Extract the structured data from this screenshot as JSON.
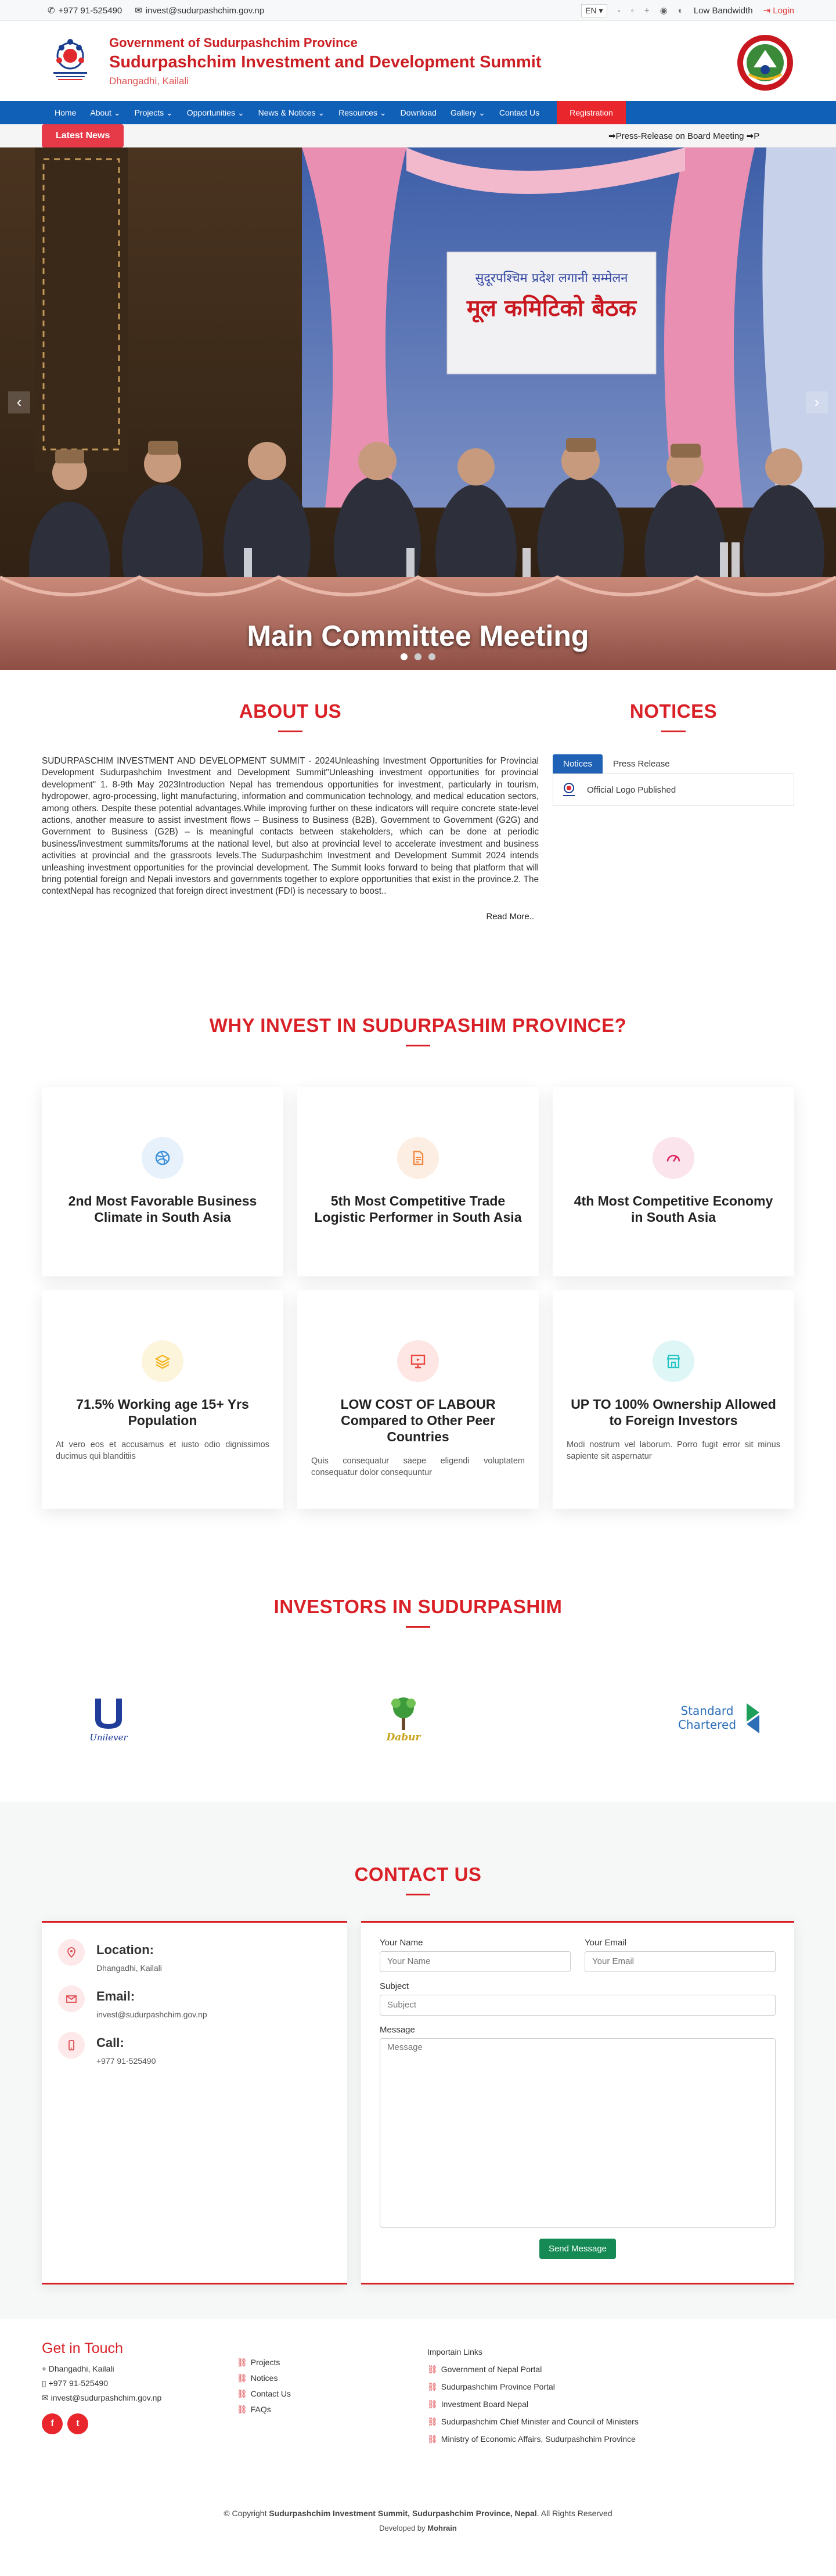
{
  "topbar": {
    "phone": "+977 91-525490",
    "email": "invest@sudurpashchim.gov.np",
    "language": "EN",
    "low_bandwidth": "Low Bandwidth",
    "login": "Login"
  },
  "header": {
    "gov_line": "Government of Sudurpashchim Province",
    "summit_title": "Sudurpashchim Investment and Development Summit",
    "location": "Dhangadhi, Kailali"
  },
  "nav": {
    "items": [
      "Home",
      "About ⌄",
      "Projects ⌄",
      "Opportunities ⌄",
      "News & Notices ⌄",
      "Resources ⌄",
      "Download",
      "Gallery ⌄",
      "Contact Us"
    ],
    "registration": "Registration"
  },
  "ticker": {
    "label": "Latest News",
    "text": "➡Press-Release on Board Meeting   ➡P"
  },
  "hero": {
    "caption": "Main Committee Meeting",
    "banner_text": "मूल कमिटिको बैठक",
    "prev": "‹",
    "next": "›"
  },
  "about": {
    "title": "ABOUT US",
    "body": "SUDURPASCHIM INVESTMENT AND DEVELOPMENT SUMMIT - 2024Unleashing Investment Opportunities for Provincial Development Sudurpashchim Investment and Development Summit\"Unleashing investment opportunities for provincial development\" 1.            8-9th May 2023Introduction Nepal has tremendous opportunities for investment, particularly in tourism, hydropower, agro-processing, light manufacturing, information and communication technology, and medical education sectors, among others. Despite these potential advantages.While improving further on these indicators will require concrete state-level actions, another measure to assist investment flows – Business to Business (B2B), Government to Government (G2G) and Government to Business (G2B) – is meaningful contacts between stakeholders, which can be done at periodic business/investment summits/forums at the national level, but also at provincial level to accelerate investment and business activities at provincial and the grassroots levels.The Sudurpashchim Investment and Development Summit 2024 intends unleashing investment opportunities for the provincial development. The Summit looks forward to being that platform that will bring potential foreign and Nepali investors and governments together to explore opportunities that exist in the province.2.           The contextNepal has recognized that foreign direct investment (FDI) is necessary to boost..",
    "read_more": "Read More.."
  },
  "notices": {
    "title": "NOTICES",
    "tabs": [
      "Notices",
      "Press Release"
    ],
    "items": [
      "Official Logo Published"
    ]
  },
  "why": {
    "title": "WHY INVEST IN SUDURPASHIM PROVINCE?",
    "cards": [
      {
        "title": "2nd Most Favorable Business Climate in South Asia",
        "text": "",
        "icon": "dribbble-icon",
        "color": "#3b8fd9",
        "bg": "#e6f1fb"
      },
      {
        "title": "5th Most Competitive Trade Logistic Performer in South Asia",
        "text": "",
        "icon": "document-icon",
        "color": "#f08a44",
        "bg": "#fdeee3"
      },
      {
        "title": "4th Most Competitive Economy in South Asia",
        "text": "",
        "icon": "speedometer-icon",
        "color": "#e0245e",
        "bg": "#fbe4ec"
      },
      {
        "title": "71.5% Working age 15+ Yrs Population",
        "text": "At vero eos et accusamus et iusto odio dignissimos ducimus qui blanditiis",
        "icon": "layers-icon",
        "color": "#f2b31b",
        "bg": "#fdf4dc"
      },
      {
        "title": "LOW COST OF LABOUR Compared to Other Peer Countries",
        "text": "Quis consequatur saepe eligendi voluptatem consequatur dolor consequuntur",
        "icon": "presentation-icon",
        "color": "#e8463c",
        "bg": "#fde6e3"
      },
      {
        "title": "UP TO 100% Ownership Allowed to Foreign Investors",
        "text": "Modi nostrum vel laborum. Porro fugit error sit minus sapiente sit aspernatur",
        "icon": "storefront-icon",
        "color": "#23c4c4",
        "bg": "#dff6f6"
      }
    ]
  },
  "investors": {
    "title": "INVESTORS IN SUDURPASHIM",
    "logos": [
      "Unilever",
      "Dabur",
      "Standard Chartered"
    ]
  },
  "contact": {
    "title": "CONTACT US",
    "location_label": "Location:",
    "location_value": "Dhangadhi, Kailali",
    "email_label": "Email:",
    "email_value": "invest@sudurpashchim.gov.np",
    "call_label": "Call:",
    "call_value": "+977 91-525490",
    "name_label": "Your Name",
    "name_placeholder": "Your Name",
    "email_field_label": "Your Email",
    "email_placeholder": "Your Email",
    "subject_label": "Subject",
    "subject_placeholder": "Subject",
    "message_label": "Message",
    "message_placeholder": "Message",
    "send": "Send Message"
  },
  "footer": {
    "touch_title": "Get in Touch",
    "address": "Dhangadhi, Kailali",
    "phone": "+977 91-525490",
    "email": "invest@sudurpashchim.gov.np",
    "quick_links": [
      "Projects",
      "Notices",
      "Contact Us",
      "FAQs"
    ],
    "links_title": "Importain Links",
    "important_links": [
      "Government of Nepal Portal",
      "Sudurpashchim Province Portal",
      "Investment Board Nepal",
      "Sudurpashchim Chief Minister and Council of Ministers",
      "Ministry of Economic Affairs, Sudurpashchim Province"
    ],
    "copyright_prefix": "© Copyright",
    "copyright_name": "Sudurpashchim Investment Summit, Sudurpashchim Province, Nepal",
    "copyright_suffix": ". All Rights Reserved",
    "developed_by": "Developed by",
    "developer": "Mohrain"
  }
}
